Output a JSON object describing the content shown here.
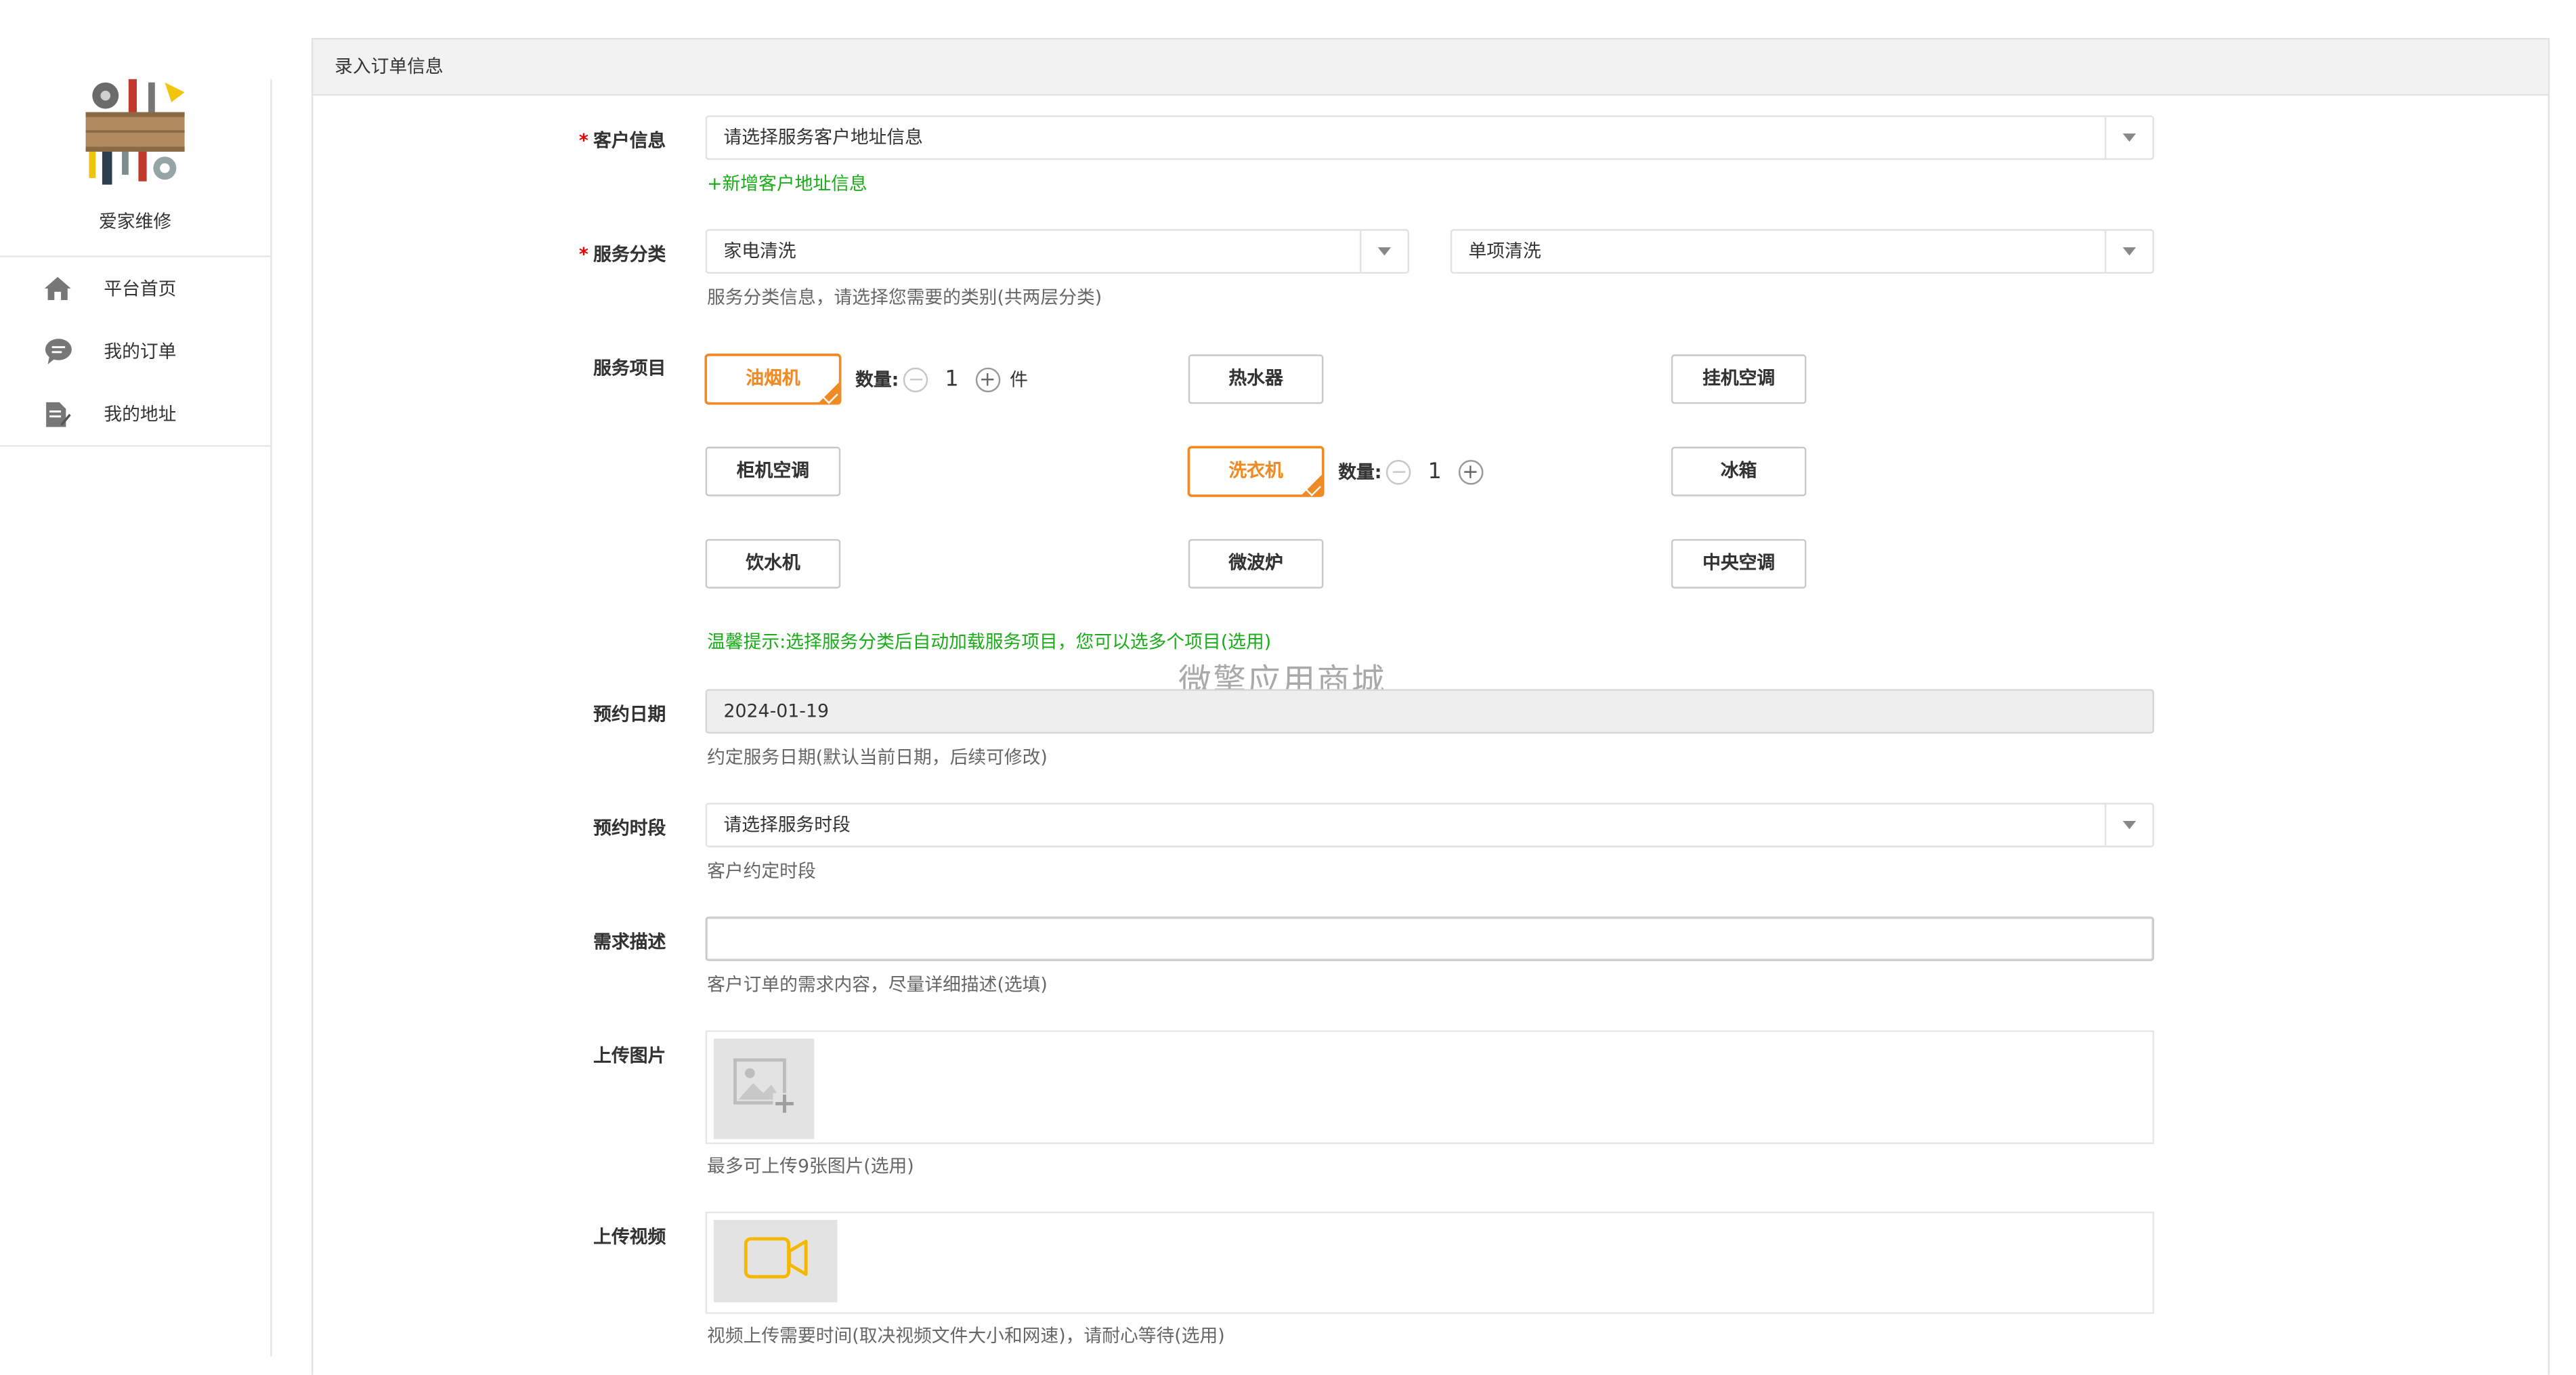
{
  "sidebar": {
    "brand": "爱家维修",
    "items": [
      {
        "label": "平台首页",
        "icon": "home-icon"
      },
      {
        "label": "我的订单",
        "icon": "chat-bubble-icon"
      },
      {
        "label": "我的地址",
        "icon": "document-edit-icon"
      }
    ]
  },
  "panel": {
    "title": "录入订单信息"
  },
  "form": {
    "customer": {
      "label": "客户信息",
      "placeholder": "请选择服务客户地址信息",
      "add_link": "+新增客户地址信息"
    },
    "category": {
      "label": "服务分类",
      "primary": "家电清洗",
      "secondary": "单项清洗",
      "hint": "服务分类信息，请选择您需要的类别(共两层分类)"
    },
    "items": {
      "label": "服务项目",
      "qty_label": "数量:",
      "unit": "件",
      "options": [
        {
          "name": "油烟机",
          "selected": true,
          "qty": "1"
        },
        {
          "name": "热水器",
          "selected": false
        },
        {
          "name": "挂机空调",
          "selected": false
        },
        {
          "name": "柜机空调",
          "selected": false
        },
        {
          "name": "洗衣机",
          "selected": true,
          "qty": "1"
        },
        {
          "name": "冰箱",
          "selected": false
        },
        {
          "name": "饮水机",
          "selected": false
        },
        {
          "name": "微波炉",
          "selected": false
        },
        {
          "name": "中央空调",
          "selected": false
        }
      ],
      "tip": "温馨提示:选择服务分类后自动加载服务项目，您可以选多个项目(选用)"
    },
    "date": {
      "label": "预约日期",
      "value": "2024-01-19",
      "hint": "约定服务日期(默认当前日期，后续可修改)"
    },
    "timeslot": {
      "label": "预约时段",
      "placeholder": "请选择服务时段",
      "hint": "客户约定时段"
    },
    "description": {
      "label": "需求描述",
      "value": "",
      "hint": "客户订单的需求内容，尽量详细描述(选填)"
    },
    "images": {
      "label": "上传图片",
      "hint": "最多可上传9张图片(选用)"
    },
    "video": {
      "label": "上传视频",
      "hint": "视频上传需要时间(取决视频文件大小和网速)，请耐心等待(选用)"
    }
  },
  "watermark": "微擎应用商城",
  "colors": {
    "accent": "#f08a24",
    "success_green": "#1aad19",
    "required_red": "#e00000",
    "video_icon": "#f5b800"
  }
}
